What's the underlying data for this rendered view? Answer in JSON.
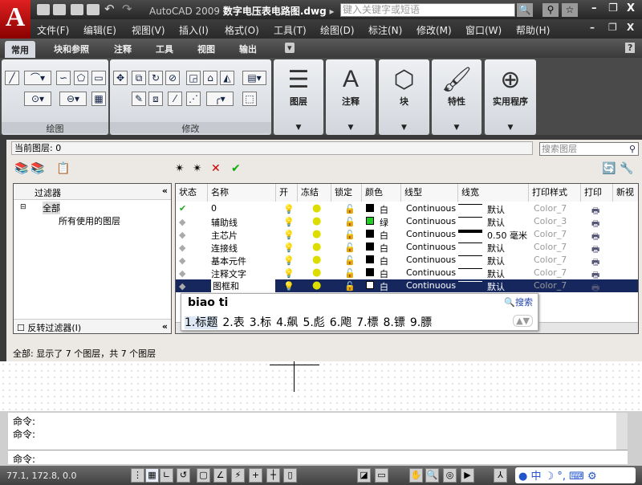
{
  "app": {
    "logo": "A",
    "title_prefix": "AutoCAD 2009",
    "filename": "数字电压表电路图.dwg",
    "keyword_placeholder": "键入关键字或短语"
  },
  "menu": [
    "文件(F)",
    "编辑(E)",
    "视图(V)",
    "插入(I)",
    "格式(O)",
    "工具(T)",
    "绘图(D)",
    "标注(N)",
    "修改(M)",
    "窗口(W)",
    "帮助(H)"
  ],
  "tabs": [
    "常用",
    "块和参照",
    "注释",
    "工具",
    "视图",
    "输出"
  ],
  "ribbon": {
    "draw": "绘图",
    "modify": "修改",
    "layers": "图层",
    "annotation": "注释",
    "block": "块",
    "properties": "特性",
    "utilities": "实用程序",
    "annotation_glyph": "A"
  },
  "layer_manager": {
    "current_layer": "当前图层: 0",
    "search_placeholder": "搜索图层",
    "filter_header": "过滤器",
    "tree": [
      "全部",
      "所有使用的图层"
    ],
    "invert_filter": "反转过滤器(I)",
    "columns": [
      "状态",
      "名称",
      "开",
      "冻结",
      "锁定",
      "颜色",
      "线型",
      "线宽",
      "打印样式",
      "打印",
      "新视"
    ],
    "layers": [
      {
        "name": "0",
        "color": "白",
        "swatch": "#000000",
        "linetype": "Continuous",
        "lineweight": "默认",
        "plot_style": "Color_7",
        "current": true
      },
      {
        "name": "辅助线",
        "color": "绿",
        "swatch": "#22cc22",
        "linetype": "Continuous",
        "lineweight": "默认",
        "plot_style": "Color_3"
      },
      {
        "name": "主芯片",
        "color": "白",
        "swatch": "#000000",
        "linetype": "Continuous",
        "lineweight": "0.50 毫米",
        "plot_style": "Color_7",
        "thick": true
      },
      {
        "name": "连接线",
        "color": "白",
        "swatch": "#000000",
        "linetype": "Continuous",
        "lineweight": "默认",
        "plot_style": "Color_7"
      },
      {
        "name": "基本元件",
        "color": "白",
        "swatch": "#000000",
        "linetype": "Continuous",
        "lineweight": "默认",
        "plot_style": "Color_7"
      },
      {
        "name": "注释文字",
        "color": "白",
        "swatch": "#000000",
        "linetype": "Continuous",
        "lineweight": "默认",
        "plot_style": "Color_7"
      },
      {
        "name": "图框和",
        "color": "白",
        "swatch": "#000000",
        "linetype": "Continuous",
        "lineweight": "默认",
        "plot_style": "Color_7",
        "selected": true
      }
    ],
    "status": "全部: 显示了 7 个图层，共 7 个图层"
  },
  "ime": {
    "input": "biao ti",
    "search": "搜索",
    "candidates": [
      "1.标题",
      "2.表",
      "3.标",
      "4.飙",
      "5.彪",
      "6.飑",
      "7.標",
      "8.镖",
      "9.膘"
    ]
  },
  "command": {
    "lines": [
      "命令:",
      "命令:"
    ],
    "prompt": "命令:"
  },
  "status": {
    "coords": "77.1,  172.8, 0.0"
  }
}
